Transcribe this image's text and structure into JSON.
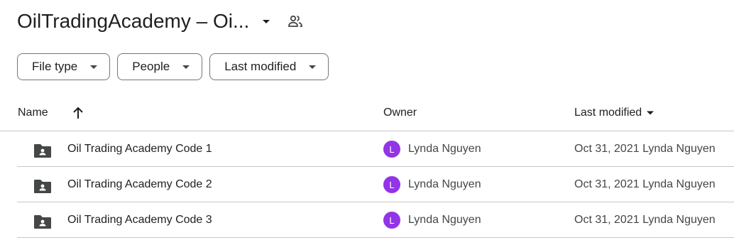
{
  "title": {
    "text": "OilTradingAcademy – Oi...",
    "caret_icon": "arrow-drop-down-icon",
    "share_icon": "shared-people-icon"
  },
  "filters": [
    {
      "label": "File type"
    },
    {
      "label": "People"
    },
    {
      "label": "Last modified"
    }
  ],
  "table": {
    "columns": {
      "name": "Name",
      "owner": "Owner",
      "last_modified": "Last modified"
    },
    "sort": {
      "column": "name",
      "direction": "ascending",
      "icon": "arrow-upward-icon"
    },
    "rows": [
      {
        "name": "Oil Trading Academy Code 1",
        "owner_initial": "L",
        "owner": "Lynda Nguyen",
        "modified": "Oct 31, 2021 Lynda Nguyen"
      },
      {
        "name": "Oil Trading Academy Code 2",
        "owner_initial": "L",
        "owner": "Lynda Nguyen",
        "modified": "Oct 31, 2021 Lynda Nguyen"
      },
      {
        "name": "Oil Trading Academy Code 3",
        "owner_initial": "L",
        "owner": "Lynda Nguyen",
        "modified": "Oct 31, 2021 Lynda Nguyen"
      }
    ]
  },
  "colors": {
    "avatar": "#9334e6",
    "border": "#c7c7c7",
    "icon": "#444746"
  }
}
